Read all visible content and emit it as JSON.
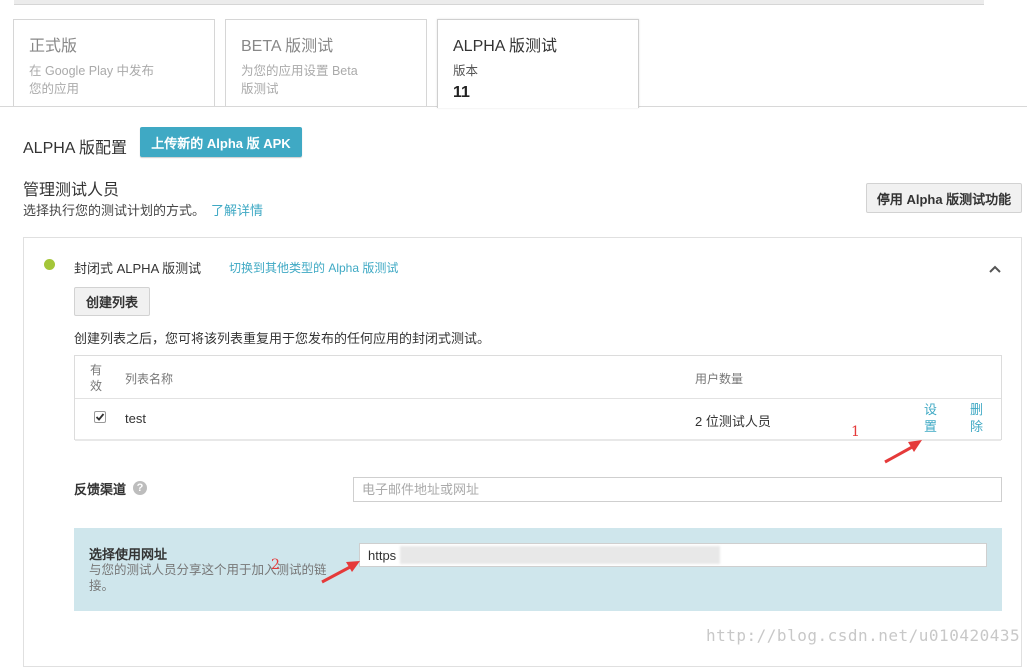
{
  "tabs": [
    {
      "title": "正式版",
      "desc": "在 Google Play 中发布您的应用"
    },
    {
      "title": "BETA 版测试",
      "desc": "为您的应用设置 Beta 版测试"
    },
    {
      "title": "ALPHA 版测试",
      "desc": "版本",
      "number": "11"
    }
  ],
  "config": {
    "label": "ALPHA 版配置",
    "upload_button": "上传新的 Alpha 版 APK"
  },
  "managers": {
    "title": "管理测试人员",
    "desc": "选择执行您的测试计划的方式。",
    "learn_more": "了解详情",
    "disable_button": "停用 Alpha 版测试功能"
  },
  "closed_test": {
    "title": "封闭式 ALPHA 版测试",
    "switch_link": "切换到其他类型的 Alpha 版测试",
    "create_button": "创建列表",
    "note": "创建列表之后，您可将该列表重复用于您发布的任何应用的封闭式测试。",
    "status_color": "#a4c639"
  },
  "list_table": {
    "headers": {
      "valid": "有效",
      "name": "列表名称",
      "users": "用户数量"
    },
    "rows": [
      {
        "checked": true,
        "name": "test",
        "users": "2 位测试人员",
        "settings": "设置",
        "delete": "删除"
      }
    ]
  },
  "feedback": {
    "label": "反馈渠道",
    "placeholder": "电子邮件地址或网址"
  },
  "opt_in": {
    "title": "选择使用网址",
    "desc": "与您的测试人员分享这个用于加入测试的链接。",
    "url_value": "https"
  },
  "annotations": [
    "1",
    "2"
  ],
  "watermark": "http://blog.csdn.net/u010420435",
  "colors": {
    "accent": "#3fa9c4",
    "annotation": "#e53a3a",
    "opt_in_bg": "#cfe6ec"
  }
}
